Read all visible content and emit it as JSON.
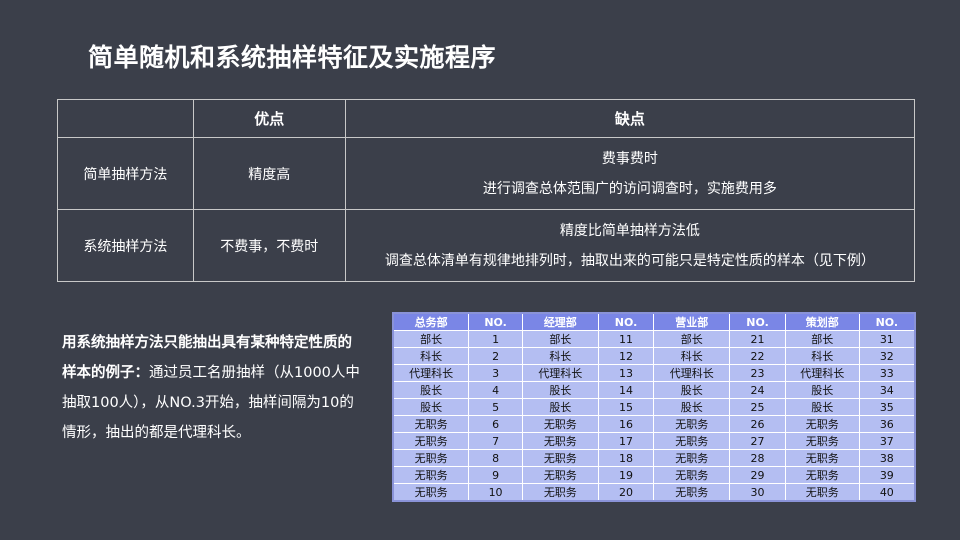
{
  "title": "简单随机和系统抽样特征及实施程序",
  "compare": {
    "headers": [
      "",
      "优点",
      "缺点"
    ],
    "rows": [
      {
        "method": "简单抽样方法",
        "pros": "精度高",
        "cons": [
          "费事费时",
          "进行调查总体范围广的访问调查时，实施费用多"
        ]
      },
      {
        "method": "系统抽样方法",
        "pros": "不费事，不费时",
        "cons": [
          "精度比简单抽样方法低",
          "调查总体清单有规律地排列时，抽取出来的可能只是特定性质的样本（见下例）"
        ]
      }
    ]
  },
  "note": {
    "bold": "用系统抽样方法只能抽出具有某种特定性质的样本的例子：",
    "text": "通过员工名册抽样（从1000人中抽取100人），从NO.3开始，抽样间隔为10的情形，抽出的都是代理科长。"
  },
  "roster": {
    "headers": [
      "总务部",
      "NO.",
      "经理部",
      "NO.",
      "营业部",
      "NO.",
      "策划部",
      "NO."
    ],
    "rows": [
      [
        "部长",
        "1",
        "部长",
        "11",
        "部长",
        "21",
        "部长",
        "31"
      ],
      [
        "科长",
        "2",
        "科长",
        "12",
        "科长",
        "22",
        "科长",
        "32"
      ],
      [
        "代理科长",
        "3",
        "代理科长",
        "13",
        "代理科长",
        "23",
        "代理科长",
        "33"
      ],
      [
        "股长",
        "4",
        "股长",
        "14",
        "股长",
        "24",
        "股长",
        "34"
      ],
      [
        "股长",
        "5",
        "股长",
        "15",
        "股长",
        "25",
        "股长",
        "35"
      ],
      [
        "无职务",
        "6",
        "无职务",
        "16",
        "无职务",
        "26",
        "无职务",
        "36"
      ],
      [
        "无职务",
        "7",
        "无职务",
        "17",
        "无职务",
        "27",
        "无职务",
        "37"
      ],
      [
        "无职务",
        "8",
        "无职务",
        "18",
        "无职务",
        "28",
        "无职务",
        "38"
      ],
      [
        "无职务",
        "9",
        "无职务",
        "19",
        "无职务",
        "29",
        "无职务",
        "39"
      ],
      [
        "无职务",
        "10",
        "无职务",
        "20",
        "无职务",
        "30",
        "无职务",
        "40"
      ]
    ]
  }
}
